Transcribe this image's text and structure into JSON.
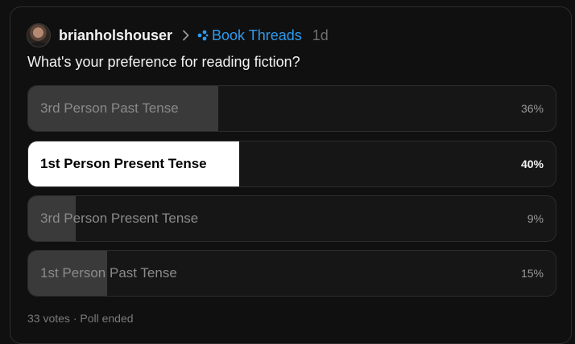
{
  "post": {
    "username": "brianholshouser",
    "community": "Book Threads",
    "age": "1d",
    "question": "What's your preference for reading fiction?"
  },
  "icons": {
    "breadcrumb_separator": "chevron-right-icon",
    "community": "community-dots-icon"
  },
  "colors": {
    "community_link": "#2d9bf0",
    "winner_fill": "#ffffff",
    "option_fill": "#3a3a3a"
  },
  "poll": {
    "options": [
      {
        "label": "3rd Person Past Tense",
        "percent": "36%",
        "fraction": 0.36,
        "winner": false
      },
      {
        "label": "1st Person Present Tense",
        "percent": "40%",
        "fraction": 0.4,
        "winner": true
      },
      {
        "label": "3rd Person Present Tense",
        "percent": "9%",
        "fraction": 0.09,
        "winner": false
      },
      {
        "label": "1st Person Past Tense",
        "percent": "15%",
        "fraction": 0.15,
        "winner": false
      }
    ],
    "summary": "33 votes · Poll ended"
  }
}
